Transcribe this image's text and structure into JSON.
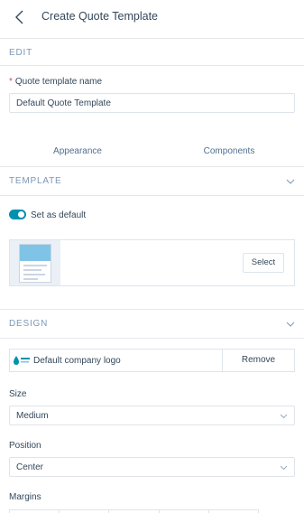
{
  "header": {
    "title": "Create Quote Template"
  },
  "edit_section": {
    "label": "EDIT"
  },
  "name_field": {
    "label": "Quote template name",
    "required_mark": "*",
    "value": "Default Quote Template"
  },
  "tabs": [
    {
      "label": "Appearance"
    },
    {
      "label": "Components"
    }
  ],
  "template_section": {
    "label": "TEMPLATE",
    "set_default_label": "Set as default",
    "set_default_on": true,
    "select_label": "Select"
  },
  "design_section": {
    "label": "DESIGN",
    "logo_label": "Default company logo",
    "remove_label": "Remove",
    "size": {
      "label": "Size",
      "value": "Medium"
    },
    "position": {
      "label": "Position",
      "value": "Center"
    },
    "margins": {
      "label": "Margins"
    }
  },
  "colors": {
    "accent": "#0091ae",
    "border": "#dfe3eb",
    "text": "#33475b",
    "muted": "#7c98b6",
    "required": "#d94c53"
  },
  "icons": [
    "back-arrow-icon",
    "chevron-down-icon",
    "caret-down-icon",
    "company-logo-icon"
  ]
}
